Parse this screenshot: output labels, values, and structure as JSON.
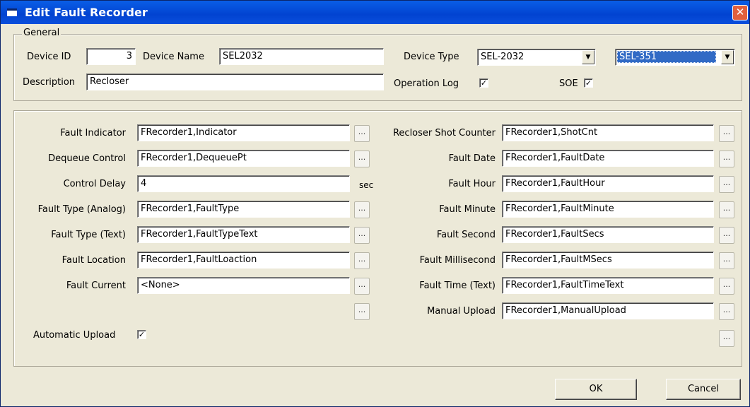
{
  "window": {
    "title": "Edit Fault Recorder",
    "close_glyph": "✕"
  },
  "general": {
    "legend": "General",
    "device_id_label": "Device ID",
    "device_id": "3",
    "device_name_label": "Device Name",
    "device_name": "SEL2032",
    "device_type_label": "Device Type",
    "device_type": "SEL-2032",
    "device_subtype": "SEL-351",
    "description_label": "Description",
    "description": "Recloser",
    "operation_log_label": "Operation Log",
    "operation_log_checked": "✓",
    "soe_label": "SOE",
    "soe_checked": "✓"
  },
  "left": {
    "fault_indicator_label": "Fault Indicator",
    "fault_indicator": "FRecorder1,Indicator",
    "dequeue_control_label": "Dequeue Control",
    "dequeue_control": "FRecorder1,DequeuePt",
    "control_delay_label": "Control Delay",
    "control_delay": "4",
    "control_delay_unit": "sec",
    "fault_type_analog_label": "Fault Type (Analog)",
    "fault_type_analog": "FRecorder1,FaultType",
    "fault_type_text_label": "Fault Type (Text)",
    "fault_type_text": "FRecorder1,FaultTypeText",
    "fault_location_label": "Fault Location",
    "fault_location": "FRecorder1,FaultLoaction",
    "fault_current_label": "Fault Current",
    "fault_current": "<None>",
    "automatic_upload_label": "Automatic Upload",
    "automatic_upload_checked": "✓"
  },
  "right": {
    "recloser_shot_counter_label": "Recloser Shot Counter",
    "recloser_shot_counter": "FRecorder1,ShotCnt",
    "fault_date_label": "Fault Date",
    "fault_date": "FRecorder1,FaultDate",
    "fault_hour_label": "Fault Hour",
    "fault_hour": "FRecorder1,FaultHour",
    "fault_minute_label": "Fault Minute",
    "fault_minute": "FRecorder1,FaultMinute",
    "fault_second_label": "Fault Second",
    "fault_second": "FRecorder1,FaultSecs",
    "fault_millisecond_label": "Fault Millisecond",
    "fault_millisecond": "FRecorder1,FaultMSecs",
    "fault_time_text_label": "Fault Time (Text)",
    "fault_time_text": "FRecorder1,FaultTimeText",
    "manual_upload_label": "Manual Upload",
    "manual_upload": "FRecorder1,ManualUpload"
  },
  "ellipsis": "...",
  "buttons": {
    "ok": "OK",
    "cancel": "Cancel"
  }
}
